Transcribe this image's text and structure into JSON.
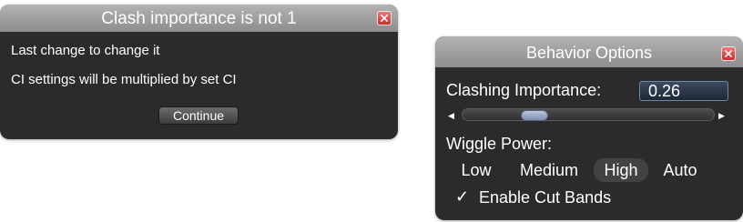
{
  "dialog1": {
    "title": "Clash importance is not 1",
    "line1": "Last change to change it",
    "line2": "CI settings will be multiplied by set CI",
    "continue_label": "Continue"
  },
  "dialog2": {
    "title": "Behavior Options",
    "clashing_importance": {
      "label": "Clashing Importance:",
      "value": "0.26",
      "slider_fraction": 0.26
    },
    "wiggle_power": {
      "label": "Wiggle Power:",
      "options": [
        "Low",
        "Medium",
        "High",
        "Auto"
      ],
      "selected": "High"
    },
    "enable_cut_bands": {
      "label": "Enable Cut Bands",
      "checked": true
    }
  },
  "colors": {
    "dialog_bg": "#2b2b2b",
    "titlebar": "#9e9e9e",
    "close_button": "#d93b3b",
    "slider_thumb": "#9eabc8",
    "selected_option": "#434343"
  },
  "icons": {
    "close": "close-icon",
    "slider_left": "arrow-left-icon",
    "slider_right": "arrow-right-icon",
    "checkbox": "checkmark-icon"
  }
}
